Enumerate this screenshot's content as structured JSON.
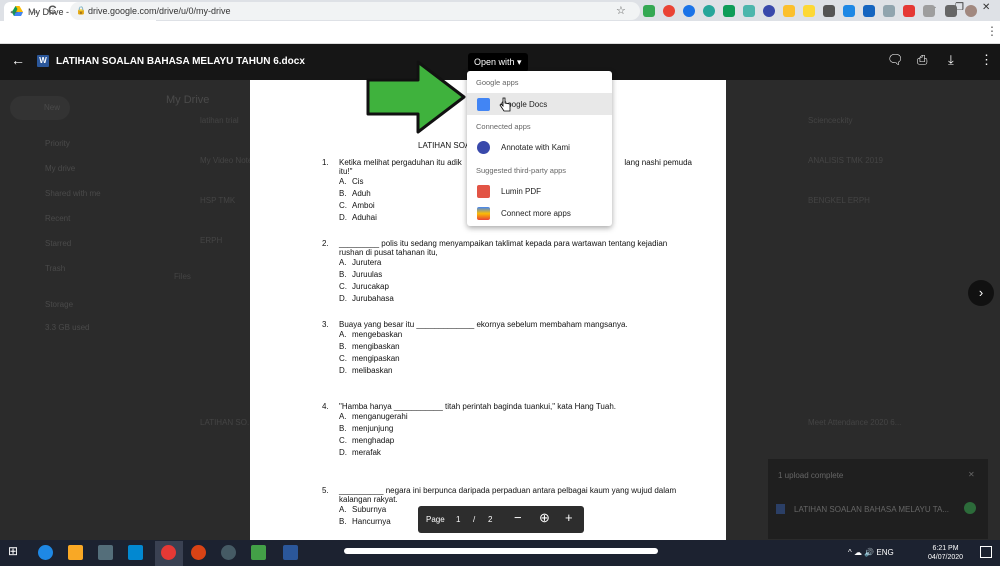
{
  "browser": {
    "tab_title": "My Drive - Google Drive",
    "tab_close": "×",
    "new_tab": "+",
    "url": "drive.google.com/drive/u/0/my-drive",
    "back": "←",
    "forward": "→",
    "reload": "C",
    "minimize": "–",
    "maximize": "❐",
    "close": "✕"
  },
  "drive": {
    "new_label": "New",
    "my_drive_label": "My Drive",
    "sidebar": [
      "Priority",
      "My drive",
      "Shared with me",
      "Recent",
      "Starred",
      "Trash",
      "Storage",
      "3.3 GB used"
    ],
    "folders_left": [
      "latihan trial",
      "My Video Notes",
      "HSP TMK",
      "ERPH"
    ],
    "files_label": "Files",
    "file_left": "LATIHAN SO...",
    "folders_right": [
      "Scienceckity",
      "ANALISIS TMK 2019",
      "BENGKEL ERPH"
    ],
    "file_right": "Meet Attendance 2020 6..."
  },
  "viewer": {
    "file_name": "LATIHAN SOALAN BAHASA MELAYU TAHUN 6.docx",
    "word_icon": "W",
    "open_with": "Open with",
    "next_button": "›"
  },
  "menu": {
    "google_apps_header": "Google apps",
    "google_docs": "Google Docs",
    "connected_apps_header": "Connected apps",
    "kami": "Annotate with Kami",
    "suggested_header": "Suggested third-party apps",
    "lumin": "Lumin PDF",
    "connect_more": "Connect more apps"
  },
  "document": {
    "title": "LATIHAN SOA",
    "questions": [
      {
        "n": "1.",
        "text": "Ketika melihat pergaduhan itu adik",
        "text2": "lang nashi pemuda",
        "cont": "itu!\"",
        "options": [
          [
            "A.",
            "Cis"
          ],
          [
            "B.",
            "Aduh"
          ],
          [
            "C.",
            "Amboi"
          ],
          [
            "D.",
            "Aduhai"
          ]
        ]
      },
      {
        "n": "2.",
        "text": "_________ polis itu sedang menyampaikan taklimat kepada para wartawan tentang kejadian",
        "cont": "rushan di pusat tahanan itu,",
        "options": [
          [
            "A.",
            "Jurutera"
          ],
          [
            "B.",
            "Juruulas"
          ],
          [
            "C.",
            "Jurucakap"
          ],
          [
            "D.",
            "Jurubahasa"
          ]
        ]
      },
      {
        "n": "3.",
        "text": "Buaya yang besar itu _____________ ekornya sebelum membaham mangsanya.",
        "options": [
          [
            "A.",
            "mengebaskan"
          ],
          [
            "B.",
            "mengibaskan"
          ],
          [
            "C.",
            "mengipaskan"
          ],
          [
            "D.",
            "melibaskan"
          ]
        ]
      },
      {
        "n": "4.",
        "text": "\"Hamba hanya ___________ titah perintah baginda tuankui,\" kata Hang Tuah.",
        "options": [
          [
            "A.",
            "menganugerahi"
          ],
          [
            "B.",
            "menjunjung"
          ],
          [
            "C.",
            "menghadap"
          ],
          [
            "D.",
            "merafak"
          ]
        ]
      },
      {
        "n": "5.",
        "text": "__________ negara ini berpunca daripada perpaduan antara pelbagai kaum yang wujud dalam",
        "cont": "kalangan rakyat.",
        "options": [
          [
            "A.",
            "Suburnya"
          ],
          [
            "B.",
            "Hancurnya"
          ]
        ]
      }
    ]
  },
  "pager": {
    "label": "Page",
    "current": "1",
    "sep": "/",
    "total": "2",
    "zoom_out": "−",
    "zoom_icon": "⊕",
    "zoom_in": "+"
  },
  "toast": {
    "text": "1 upload complete",
    "file": "LATIHAN SOALAN BAHASA MELAYU TA..."
  },
  "taskbar": {
    "lang": "ENG",
    "time": "6:21 PM",
    "date": "04/07/2020"
  }
}
